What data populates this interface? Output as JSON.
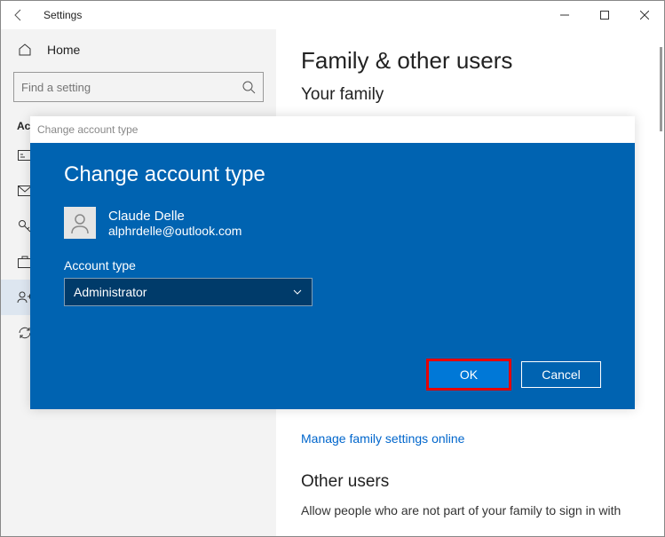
{
  "window": {
    "title": "Settings"
  },
  "sidebar": {
    "home": "Home",
    "search_placeholder": "Find a setting",
    "section": "Accounts",
    "items": [
      {
        "label": "Your info"
      },
      {
        "label": "Email & accounts"
      },
      {
        "label": "Sign-in options"
      },
      {
        "label": "Access work or school"
      },
      {
        "label": "Family & other users"
      },
      {
        "label": "Sync your settings"
      }
    ]
  },
  "main": {
    "title": "Family & other users",
    "your_family": "Your family",
    "manage_link": "Manage family settings online",
    "other_users": "Other users",
    "other_users_desc": "Allow people who are not part of your family to sign in with"
  },
  "modal": {
    "header": "Change account type",
    "title": "Change account type",
    "user_name": "Claude Delle",
    "user_email": "alphrdelle@outlook.com",
    "field_label": "Account type",
    "selected": "Administrator",
    "ok": "OK",
    "cancel": "Cancel"
  }
}
